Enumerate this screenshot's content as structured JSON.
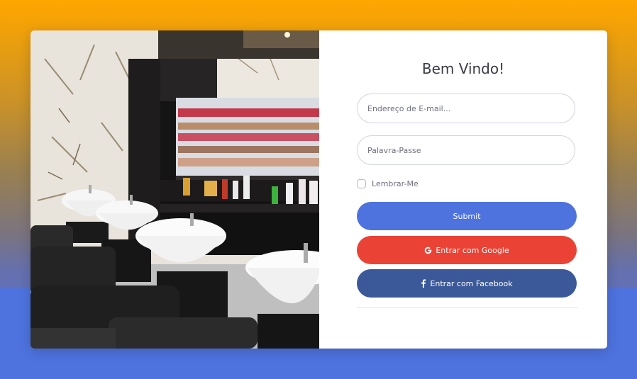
{
  "login": {
    "title": "Bem Vindo!",
    "email_placeholder": "Endereço de E-mail...",
    "password_placeholder": "Palavra-Passe",
    "remember_label": "Lembrar-Me",
    "submit_label": "Submit",
    "google_label": "Entrar com Google",
    "facebook_label": "Entrar com Facebook"
  },
  "icons": {
    "google": "google-icon",
    "facebook": "facebook-icon"
  },
  "colors": {
    "background_top": "#ffa600",
    "background_bottom": "#4e73df",
    "submit": "#4e73df",
    "google": "#ea4335",
    "facebook": "#3b5998"
  }
}
